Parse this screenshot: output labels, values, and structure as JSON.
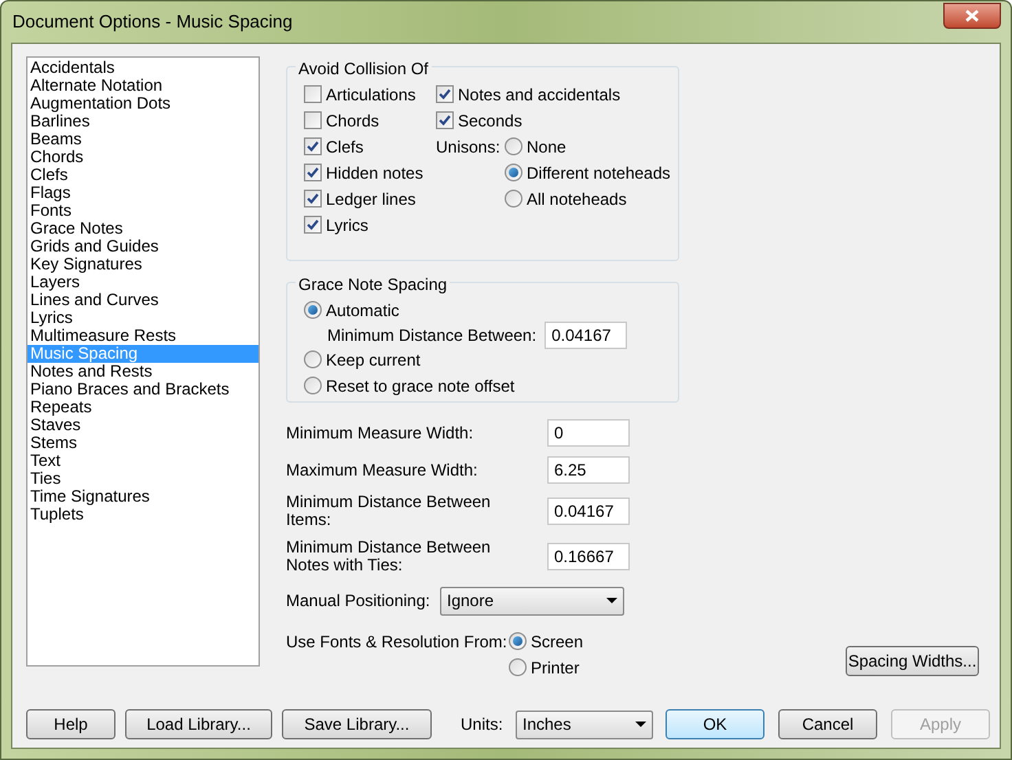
{
  "window": {
    "title": "Document Options - Music Spacing"
  },
  "sidebar": {
    "items": [
      {
        "label": "Accidentals",
        "selected": false
      },
      {
        "label": "Alternate Notation",
        "selected": false
      },
      {
        "label": "Augmentation Dots",
        "selected": false
      },
      {
        "label": "Barlines",
        "selected": false
      },
      {
        "label": "Beams",
        "selected": false
      },
      {
        "label": "Chords",
        "selected": false
      },
      {
        "label": "Clefs",
        "selected": false
      },
      {
        "label": "Flags",
        "selected": false
      },
      {
        "label": "Fonts",
        "selected": false
      },
      {
        "label": "Grace Notes",
        "selected": false
      },
      {
        "label": "Grids and Guides",
        "selected": false
      },
      {
        "label": "Key Signatures",
        "selected": false
      },
      {
        "label": "Layers",
        "selected": false
      },
      {
        "label": "Lines and Curves",
        "selected": false
      },
      {
        "label": "Lyrics",
        "selected": false
      },
      {
        "label": "Multimeasure Rests",
        "selected": false
      },
      {
        "label": "Music Spacing",
        "selected": true
      },
      {
        "label": "Notes and Rests",
        "selected": false
      },
      {
        "label": "Piano Braces and Brackets",
        "selected": false
      },
      {
        "label": "Repeats",
        "selected": false
      },
      {
        "label": "Staves",
        "selected": false
      },
      {
        "label": "Stems",
        "selected": false
      },
      {
        "label": "Text",
        "selected": false
      },
      {
        "label": "Ties",
        "selected": false
      },
      {
        "label": "Time Signatures",
        "selected": false
      },
      {
        "label": "Tuplets",
        "selected": false
      }
    ]
  },
  "collision": {
    "title": "Avoid Collision Of",
    "left_checks": [
      {
        "label": "Articulations",
        "checked": false
      },
      {
        "label": "Chords",
        "checked": false
      },
      {
        "label": "Clefs",
        "checked": true
      },
      {
        "label": "Hidden notes",
        "checked": true
      },
      {
        "label": "Ledger lines",
        "checked": true
      },
      {
        "label": "Lyrics",
        "checked": true
      }
    ],
    "right_checks": [
      {
        "label": "Notes and accidentals",
        "checked": true
      },
      {
        "label": "Seconds",
        "checked": true
      }
    ],
    "unisons": {
      "label": "Unisons:",
      "options": [
        {
          "label": "None",
          "selected": false
        },
        {
          "label": "Different noteheads",
          "selected": true
        },
        {
          "label": "All noteheads",
          "selected": false
        }
      ]
    }
  },
  "grace": {
    "title": "Grace Note Spacing",
    "options": [
      {
        "label": "Automatic",
        "selected": true,
        "field": {
          "label": "Minimum Distance Between:",
          "value": "0.04167"
        }
      },
      {
        "label": "Keep current",
        "selected": false
      },
      {
        "label": "Reset to grace note offset",
        "selected": false
      }
    ]
  },
  "measure_fields": [
    {
      "label": "Minimum Measure Width:",
      "value": "0"
    },
    {
      "label": "Maximum Measure Width:",
      "value": "6.25"
    },
    {
      "label": "Minimum Distance Between Items:",
      "value": "0.04167"
    },
    {
      "label": "Minimum Distance Between Notes with Ties:",
      "value": "0.16667"
    }
  ],
  "manual_positioning": {
    "label": "Manual Positioning:",
    "value": "Ignore"
  },
  "fonts_from": {
    "label": "Use Fonts & Resolution From:",
    "options": [
      {
        "label": "Screen",
        "selected": true
      },
      {
        "label": "Printer",
        "selected": false
      }
    ]
  },
  "spacing_widths_button": "Spacing Widths...",
  "footer": {
    "buttons": [
      {
        "label": "Help"
      },
      {
        "label": "Load Library..."
      },
      {
        "label": "Save Library..."
      }
    ],
    "units": {
      "label": "Units:",
      "value": "Inches"
    },
    "actions": [
      {
        "label": "OK",
        "kind": "default",
        "disabled": false
      },
      {
        "label": "Cancel",
        "kind": "normal",
        "disabled": false
      },
      {
        "label": "Apply",
        "kind": "normal",
        "disabled": true
      }
    ]
  }
}
